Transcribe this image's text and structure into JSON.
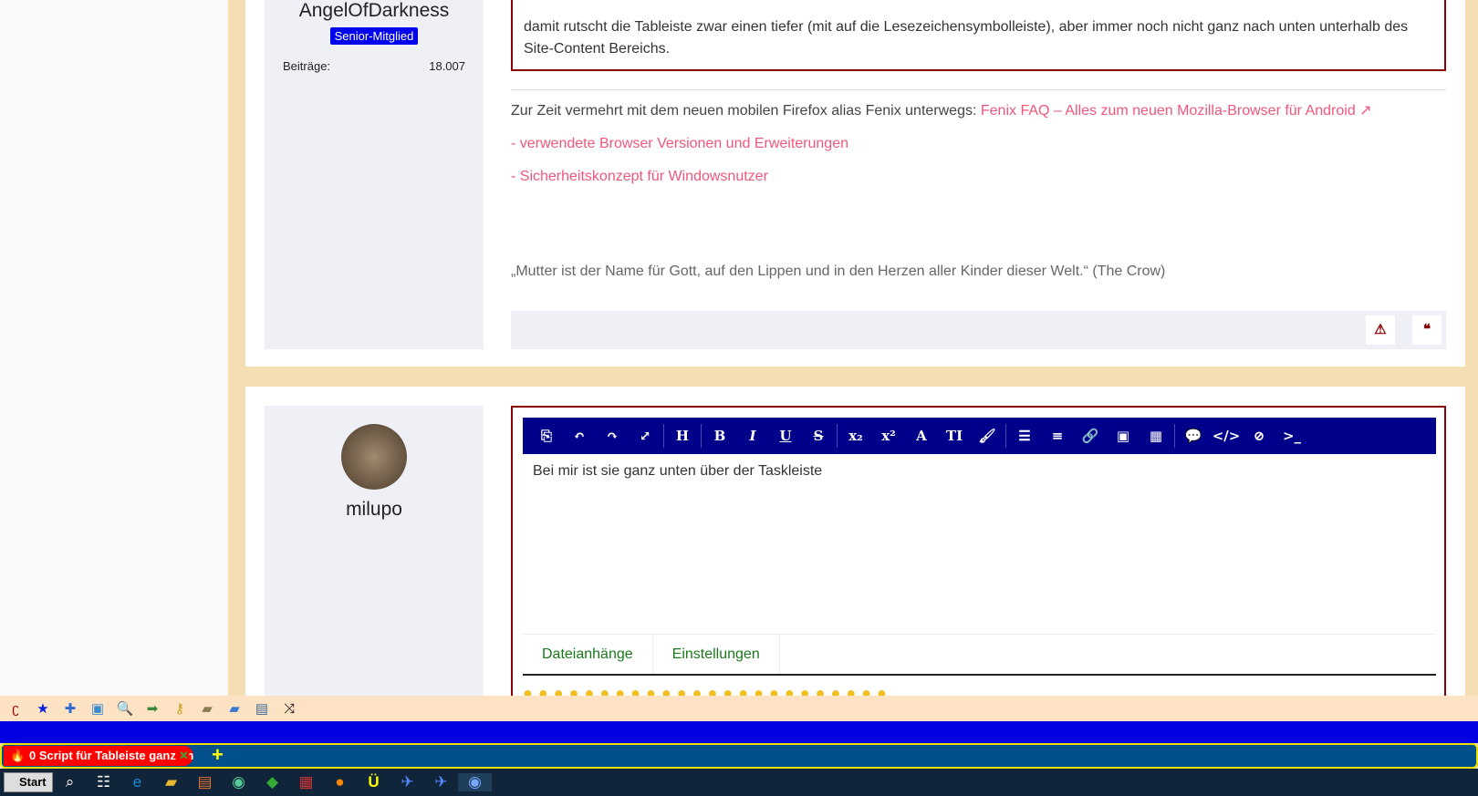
{
  "post1": {
    "author": "AngelOfDarkness",
    "rank": "Senior-Mitglied",
    "stat_label": "Beiträge:",
    "stat_value": "18.007",
    "quote_text": "damit rutscht die Tableiste zwar einen tiefer (mit auf die Lesezeichensymbolleiste), aber immer noch nicht ganz nach unten unterhalb des Site-Content Bereichs.",
    "sig_text": "Zur Zeit vermehrt mit dem neuen mobilen Firefox alias Fenix unterwegs: ",
    "sig_link": "Fenix FAQ – Alles zum neuen Mozilla-Browser für Android",
    "link2": "- verwendete Browser Versionen und Erweiterungen",
    "link3": "- Sicherheitskonzept für Windowsnutzer",
    "motto": "„Mutter ist der Name für Gott, auf den Lippen und in den Herzen aller Kinder dieser Welt.“ (The Crow)"
  },
  "post2": {
    "author": "milupo",
    "editor_text": "Bei mir ist sie ganz unten über der Taskleiste",
    "tabs": [
      "Dateianhänge",
      "Einstellungen"
    ]
  },
  "toolbar": [
    "source",
    "undo",
    "redo",
    "fullscreen",
    "heading",
    "bold",
    "italic",
    "underline",
    "strikethrough",
    "subscript",
    "superscript",
    "font-color",
    "font-size",
    "brush",
    "list",
    "align",
    "link",
    "image",
    "table",
    "spoiler",
    "code",
    "hide",
    "terminal"
  ],
  "browser": {
    "tab_title": "0 Script für Tableiste ganz unten",
    "new_tab": "+",
    "start": "Start"
  }
}
